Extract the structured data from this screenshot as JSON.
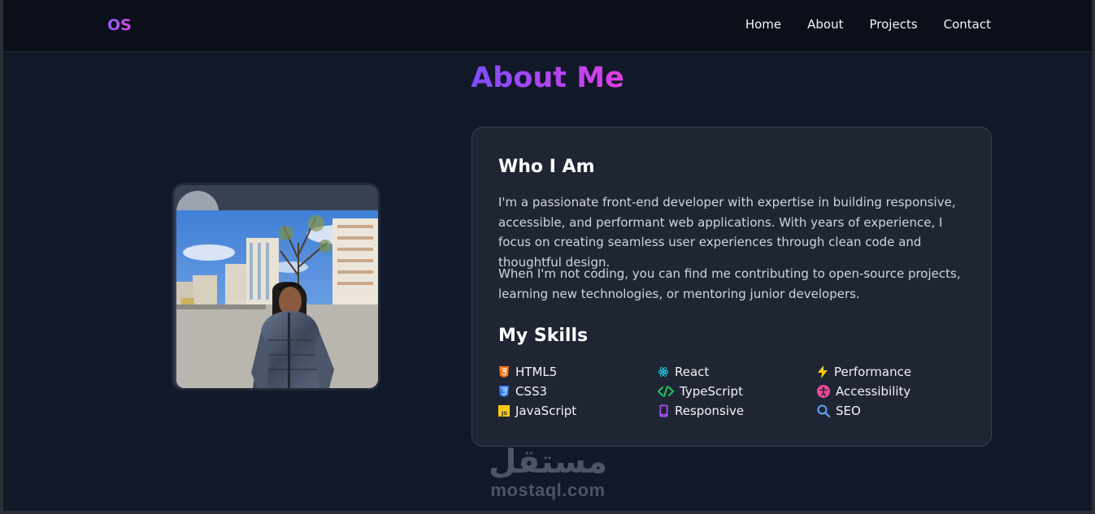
{
  "nav": {
    "logo": "OS",
    "links": [
      "Home",
      "About",
      "Projects",
      "Contact"
    ]
  },
  "about": {
    "title": "About Me",
    "who_heading": "Who I Am",
    "paragraph1": "I'm a passionate front-end developer with expertise in building responsive, accessible, and performant web applications. With years of experience, I focus on creating seamless user experiences through clean code and thoughtful design.",
    "paragraph2": "When I'm not coding, you can find me contributing to open-source projects, learning new technologies, or mentoring junior developers.",
    "skills_heading": "My Skills",
    "skills": [
      {
        "label": "HTML5",
        "icon": "html5-icon",
        "color": "#f97316"
      },
      {
        "label": "React",
        "icon": "react-icon",
        "color": "#22d3ee"
      },
      {
        "label": "Performance",
        "icon": "bolt-icon",
        "color": "#facc15"
      },
      {
        "label": "CSS3",
        "icon": "css3-icon",
        "color": "#3b82f6"
      },
      {
        "label": "TypeScript",
        "icon": "code-icon",
        "color": "#22c55e"
      },
      {
        "label": "Accessibility",
        "icon": "accessibility-icon",
        "color": "#ec4899"
      },
      {
        "label": "JavaScript",
        "icon": "js-icon",
        "color": "#facc15"
      },
      {
        "label": "Responsive",
        "icon": "mobile-icon",
        "color": "#a855f7"
      },
      {
        "label": "SEO",
        "icon": "search-icon",
        "color": "#60a5fa"
      }
    ]
  },
  "watermark": {
    "arabic": "مستقل",
    "latin": "mostaql.com"
  },
  "colors": {
    "background": "#111827",
    "card": "#1f2533",
    "accent_start": "#7c4dff",
    "accent_end": "#e03ee6"
  }
}
